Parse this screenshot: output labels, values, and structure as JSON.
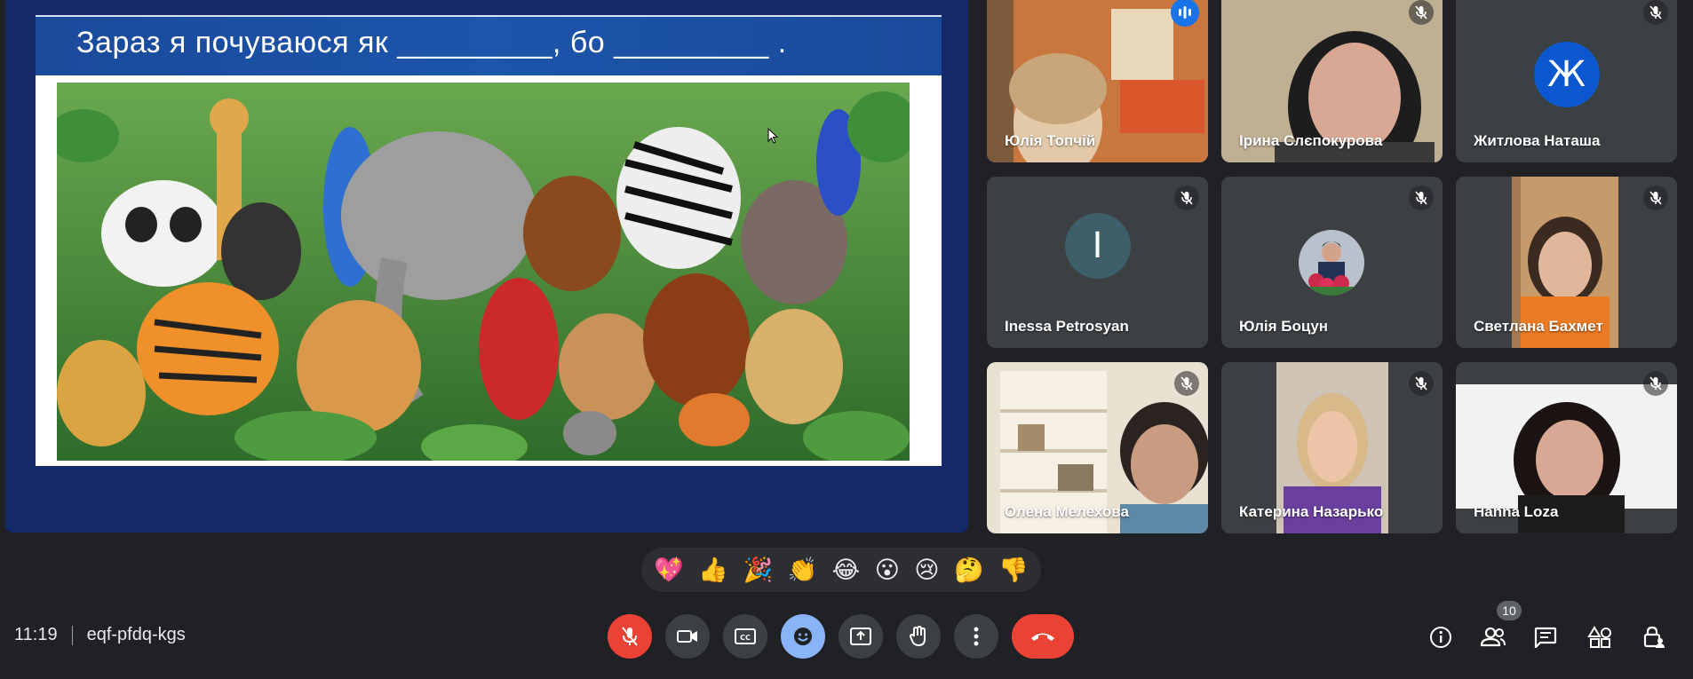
{
  "presentation": {
    "slide_title": "Зараз я почуваюся як _________, бо _________ .",
    "image_alt": "jungle animals illustration"
  },
  "participants": [
    {
      "name": "Юлія Топчій",
      "status": "speaking",
      "video": true
    },
    {
      "name": "Ірина Слєпокурова",
      "status": "muted",
      "video": true
    },
    {
      "name": "Житлова Наташа",
      "status": "muted",
      "video": false,
      "avatar_letter": "Ж",
      "avatar_color": "#0b57d0"
    },
    {
      "name": "Inessa Petrosyan",
      "status": "muted",
      "video": false,
      "avatar_letter": "I",
      "avatar_color": "#3d5f6a"
    },
    {
      "name": "Юлія Боцун",
      "status": "muted",
      "video": false
    },
    {
      "name": "Светлана Бахмет",
      "status": "muted",
      "video": true
    },
    {
      "name": "Олена Мелехова",
      "status": "muted",
      "video": true
    },
    {
      "name": "Катерина Назарько",
      "status": "muted",
      "video": true
    },
    {
      "name": "Hanna Loza",
      "status": "muted",
      "video": true
    }
  ],
  "reactions": [
    "💖",
    "👍",
    "🎉",
    "👏",
    "😂",
    "😮",
    "😢",
    "🤔",
    "👎"
  ],
  "meeting": {
    "time": "11:19",
    "code": "eqf-pfdq-kgs",
    "participant_count": "10"
  },
  "colors": {
    "background": "#202124",
    "tile": "#3c4043",
    "accent_blue": "#8ab4f8",
    "danger": "#ea4335"
  }
}
